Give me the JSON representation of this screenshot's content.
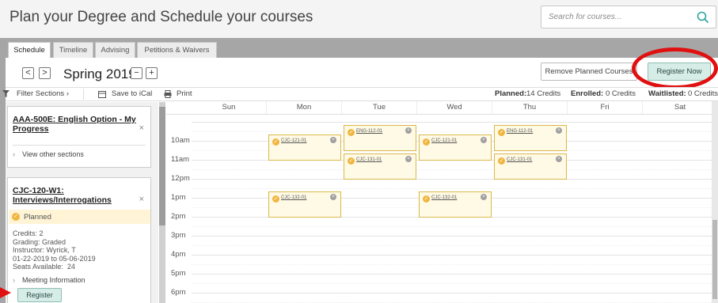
{
  "header": {
    "title": "Plan your Degree and Schedule your courses",
    "search_placeholder": "Search for courses..."
  },
  "tabs": [
    {
      "label": "Schedule",
      "active": true
    },
    {
      "label": "Timeline"
    },
    {
      "label": "Advising"
    },
    {
      "label": "Petitions & Waivers"
    }
  ],
  "term": {
    "prev": "<",
    "next": ">",
    "label": "Spring 2019",
    "remove": "−",
    "add": "+"
  },
  "actions": {
    "remove_planned": "Remove Planned Courses",
    "register_now": "Register Now"
  },
  "toolbar": {
    "filter": "Filter Sections ›",
    "ical": "Save to iCal",
    "print": "Print",
    "planned_label": "Planned:",
    "planned_value": "14 Credits",
    "enrolled_label": "Enrolled:",
    "enrolled_value": "0 Credits",
    "waitlisted_label": "Waitlisted:",
    "waitlisted_value": "0 Credits"
  },
  "course1": {
    "title": "AAA-500E: English Option - My Progress",
    "view_other": "View other sections",
    "close": "×"
  },
  "course2": {
    "title": "CJC-120-W1: Interviews/Interrogations",
    "close": "×",
    "status": "Planned",
    "credits": "Credits: 2",
    "grading": "Grading: Graded",
    "instructor": "Instructor: Wyrick, T",
    "dates": "01-22-2019 to 05-06-2019",
    "seats": "Seats Available:  24",
    "meeting": "Meeting Information",
    "register": "Register"
  },
  "calendar": {
    "days": [
      "Sun",
      "Mon",
      "Tue",
      "Wed",
      "Thu",
      "Fri",
      "Sat"
    ],
    "times": [
      "10am",
      "11am",
      "12pm",
      "1pm",
      "2pm",
      "3pm",
      "4pm",
      "5pm",
      "6pm"
    ],
    "events": [
      {
        "code": "CJC-121-01",
        "day": "Mon",
        "start": 10.0
      },
      {
        "code": "ENG-112-01",
        "day": "Tue",
        "start": 9.5
      },
      {
        "code": "CJC-121-01",
        "day": "Wed",
        "start": 10.0
      },
      {
        "code": "ENG-112-01",
        "day": "Thu",
        "start": 9.5
      },
      {
        "code": "CJC-131-01",
        "day": "Tue",
        "start": 11.0
      },
      {
        "code": "CJC-131-01",
        "day": "Thu",
        "start": 11.0
      },
      {
        "code": "CJC-132-01",
        "day": "Mon",
        "start": 13.0
      },
      {
        "code": "CJC-132-01",
        "day": "Wed",
        "start": 13.0
      }
    ]
  },
  "colors": {
    "accent": "#d6ece6",
    "annotation": "#e01010",
    "event_bg": "#fffae5",
    "event_border": "#d9b84a",
    "planned": "#f0b53f"
  },
  "icons": [
    "search-icon",
    "filter-icon",
    "calendar-icon",
    "print-icon",
    "check-icon",
    "close-icon",
    "chevron-right-icon",
    "remove-circle-icon",
    "arrow-right-icon"
  ]
}
